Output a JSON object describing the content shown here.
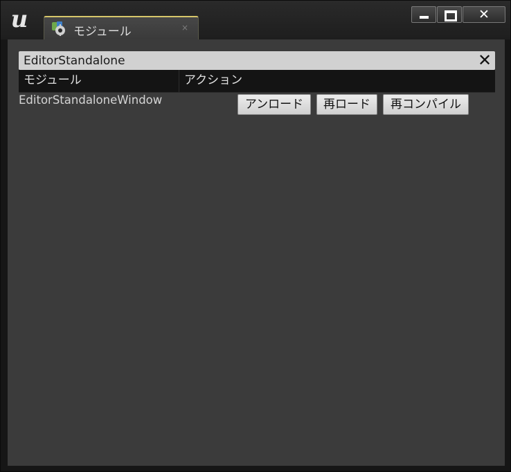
{
  "window": {
    "tab": {
      "label": "モジュール",
      "icon": "gear-puzzle-icon",
      "close_glyph": "×"
    },
    "controls": {
      "minimize": "minimize-icon",
      "maximize": "maximize-icon",
      "close": "✕"
    }
  },
  "search": {
    "value": "EditorStandalone",
    "clear_glyph": "✕"
  },
  "table": {
    "columns": [
      "モジュール",
      "アクション"
    ],
    "rows": [
      {
        "module": "EditorStandaloneWindow",
        "actions": [
          "アンロード",
          "再ロード",
          "再コンパイル"
        ]
      }
    ]
  },
  "colors": {
    "panel": "#3b3b3b",
    "header": "#141414",
    "tab_accent": "#d8c76a"
  }
}
